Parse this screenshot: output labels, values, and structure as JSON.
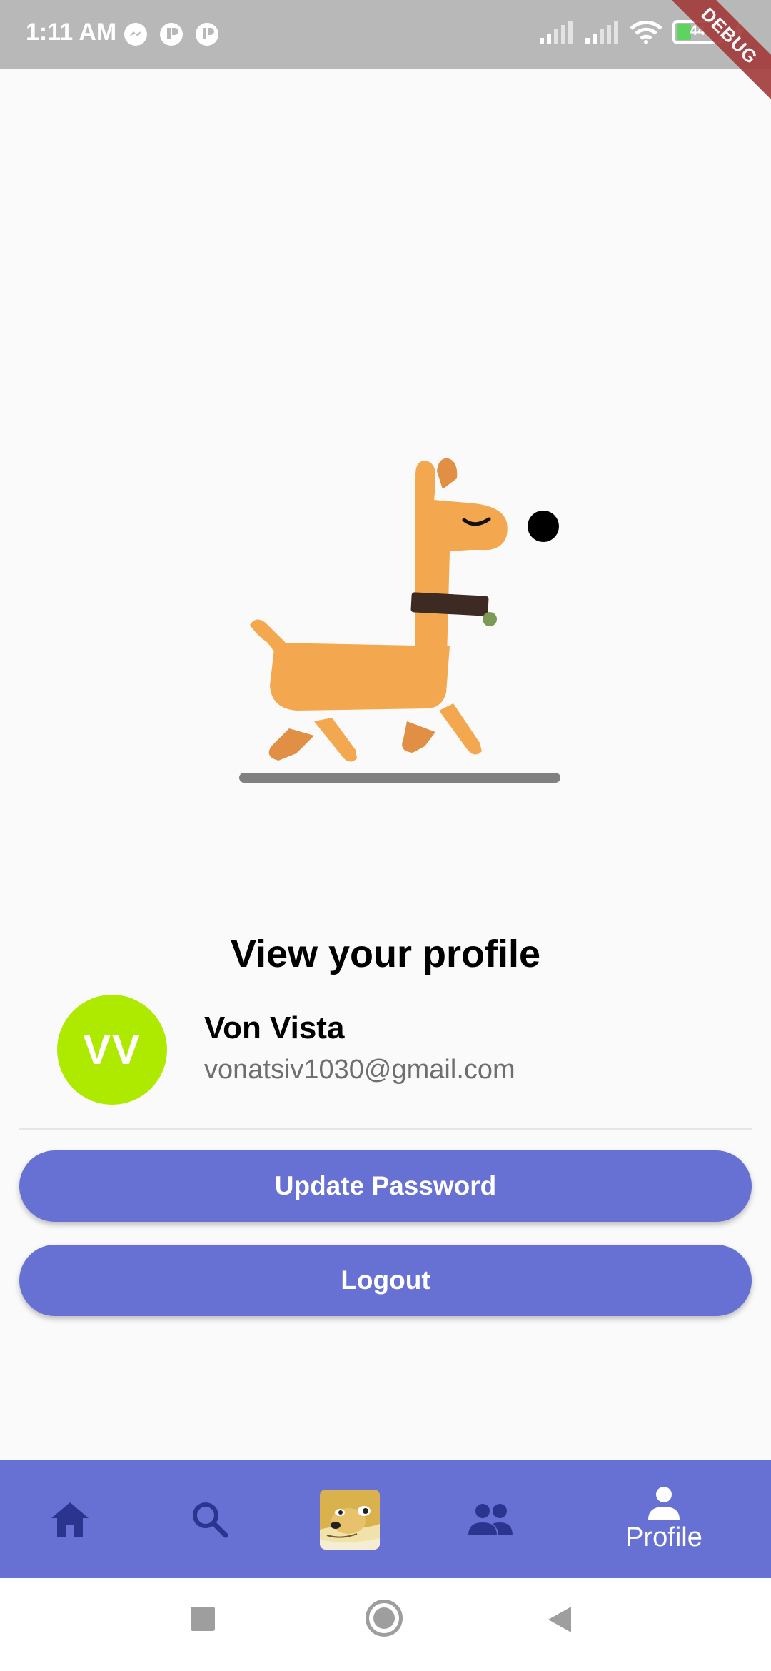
{
  "status_bar": {
    "time": "1:11 AM",
    "battery": "44",
    "icons": [
      "messenger-icon",
      "app-notification-icon",
      "app-notification-icon",
      "signal-icon",
      "signal-icon",
      "wifi-icon",
      "battery-icon",
      "charging-icon"
    ]
  },
  "debug_banner": "DEBUG",
  "page": {
    "title": "View your profile"
  },
  "profile": {
    "initials": "VV",
    "name": "Von Vista",
    "email": "vonatsiv1030@gmail.com",
    "avatar_color": "#aeea00"
  },
  "buttons": {
    "update_password": "Update Password",
    "logout": "Logout"
  },
  "bottom_nav": {
    "items": [
      {
        "icon": "home-icon",
        "label": ""
      },
      {
        "icon": "search-icon",
        "label": ""
      },
      {
        "icon": "doge-app-icon",
        "label": ""
      },
      {
        "icon": "people-icon",
        "label": ""
      },
      {
        "icon": "person-icon",
        "label": "Profile"
      }
    ],
    "active_index": 4
  },
  "colors": {
    "accent": "#6671d3",
    "nav_inactive": "#2b3590",
    "status_bar": "#b8b8b8"
  }
}
